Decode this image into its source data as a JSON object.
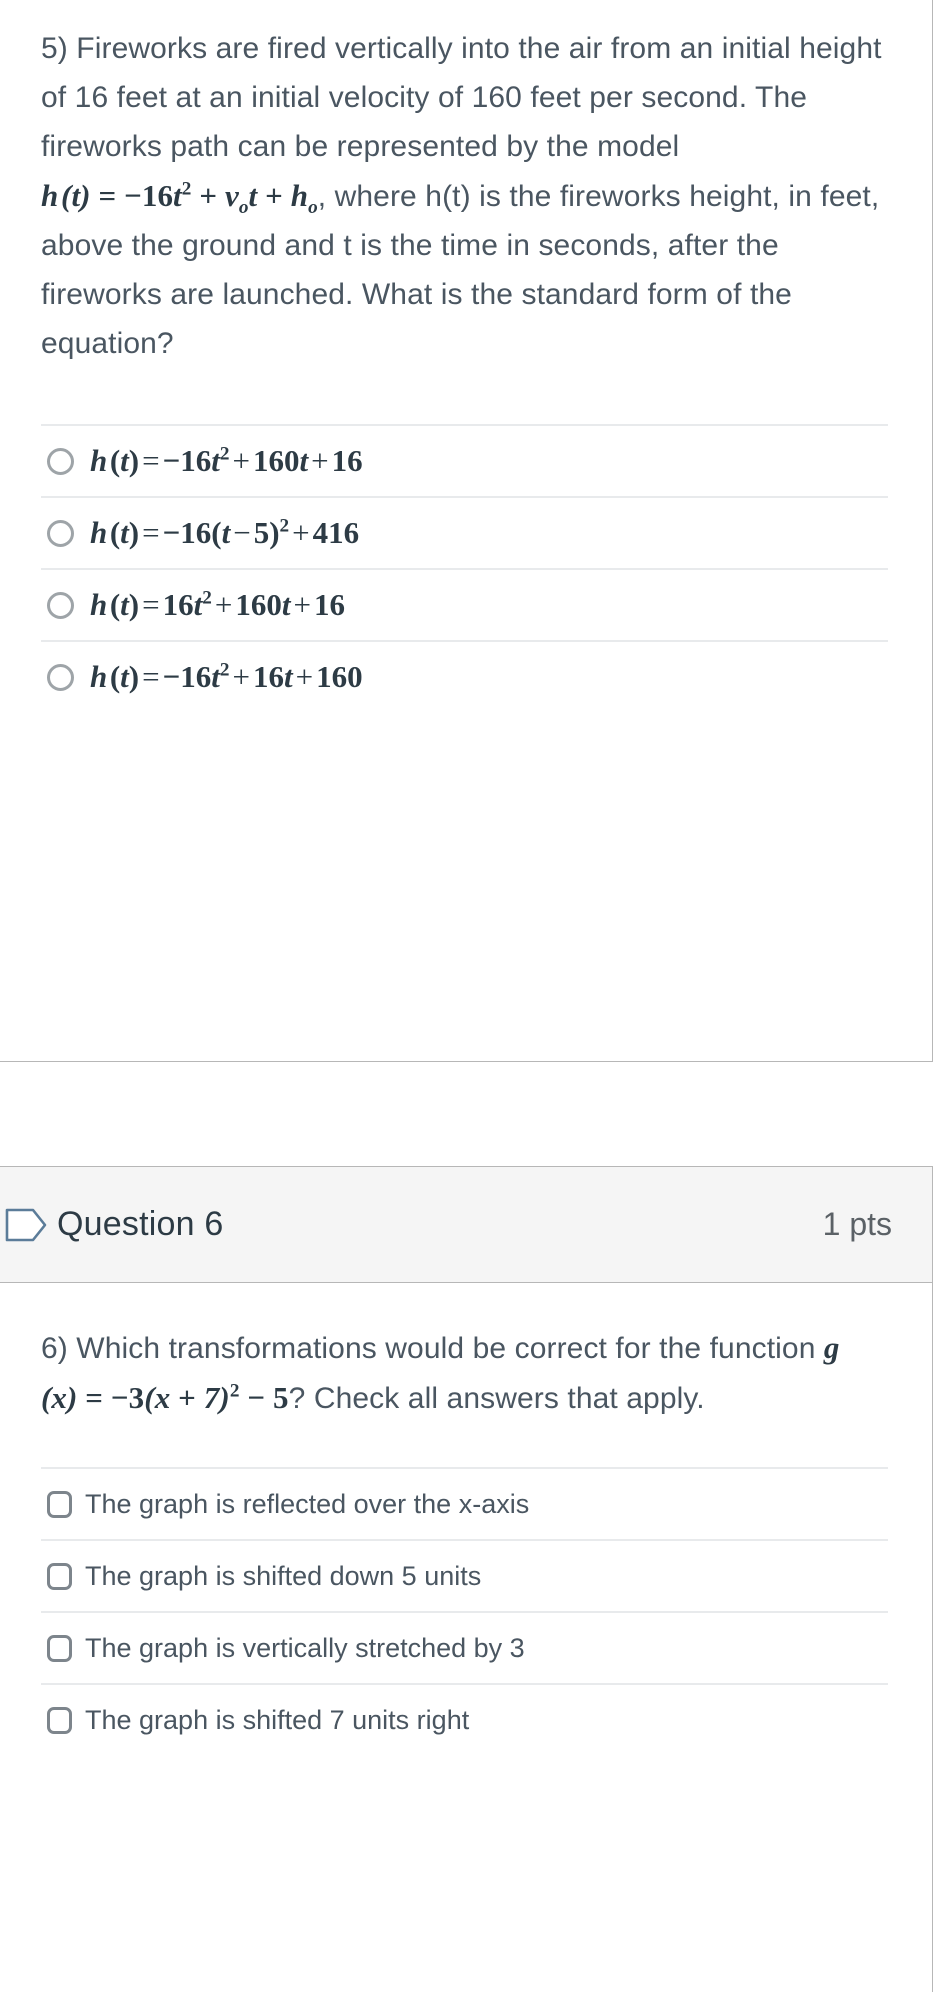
{
  "question5": {
    "prompt_lines": [
      "5) Fireworks are fired vertically into the air from an initial height of 16 feet at an initial velocity of 160 feet per second.  The fireworks path can be represented by the model",
      ", where h(t) is the fireworks height, in feet, above the ground and t is the time in seconds, after the fireworks are launched.  What is the standard form of the equation?"
    ],
    "prompt_part1": "5) Fireworks are fired vertically into the air from an initial height of 16 feet at an initial velocity of 160 feet per second.  The fireworks path can be represented by the model",
    "prompt_part2": ", where h(t) is the fireworks height, in feet, above the ground and t is the time in seconds, after the fireworks are launched.  What is the standard form of the equation?",
    "model_formula": "h (t) = −16t² + vₒt + hₒ",
    "options": [
      {
        "id": "q5-opt-1",
        "formula": "h (t) = −16t² + 160t + 16",
        "input": "radio",
        "checked": false
      },
      {
        "id": "q5-opt-2",
        "formula": "h (t) = −16(t − 5)² + 416",
        "input": "radio",
        "checked": false
      },
      {
        "id": "q5-opt-3",
        "formula": "h (t) = 16t² + 160t + 16",
        "input": "radio",
        "checked": false
      },
      {
        "id": "q5-opt-4",
        "formula": "h (t) = −16t² + 16t + 160",
        "input": "radio",
        "checked": false
      }
    ]
  },
  "question6": {
    "header": {
      "flag_icon": "flag-outline-icon",
      "title": "Question 6",
      "points": "1 pts",
      "background_color": "#f5f5f5",
      "border_color": "#b7b7b7",
      "icon_color": "#5b7c99"
    },
    "prompt_part1": "6) Which transformations would be correct for the function ",
    "formula": "g (x) = −3(x + 7)² − 5",
    "prompt_part2": "? Check all answers that apply.",
    "options": [
      {
        "id": "q6-opt-1",
        "label": "The graph is reflected over the x-axis",
        "input": "checkbox",
        "checked": false
      },
      {
        "id": "q6-opt-2",
        "label": "The graph is shifted down 5 units",
        "input": "checkbox",
        "checked": false
      },
      {
        "id": "q6-opt-3",
        "label": "The graph is vertically stretched by 3",
        "input": "checkbox",
        "checked": false
      },
      {
        "id": "q6-opt-4",
        "label": "The graph is shifted 7 units right",
        "input": "checkbox",
        "checked": false
      }
    ]
  },
  "colors": {
    "body_text": "#4a5661",
    "math_text": "#2d3b45",
    "divider": "#e8eaec",
    "container_border": "#b7b7b7",
    "control_outline": "#9ea4a8"
  }
}
